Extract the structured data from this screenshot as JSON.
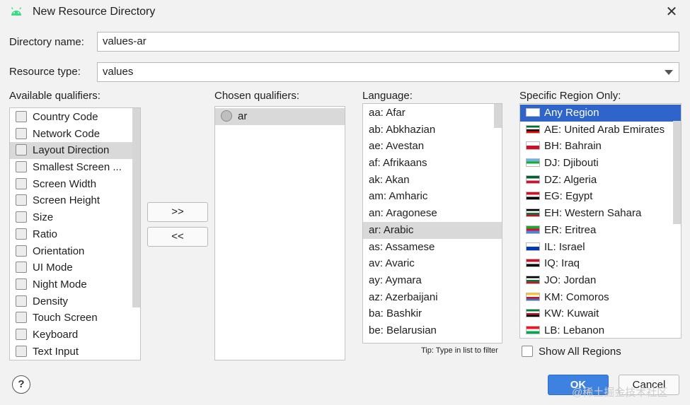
{
  "window": {
    "title": "New Resource Directory",
    "close_glyph": "✕",
    "app_icon": "android-icon"
  },
  "directory_name": {
    "label": "Directory name:",
    "value": "values-ar"
  },
  "resource_type": {
    "label": "Resource type:",
    "value": "values"
  },
  "available": {
    "label": "Available qualifiers:",
    "items": [
      {
        "label": "Country Code",
        "icon": "country-code-icon"
      },
      {
        "label": "Network Code",
        "icon": "network-code-icon"
      },
      {
        "label": "Layout Direction",
        "icon": "layout-direction-icon"
      },
      {
        "label": "Smallest Screen ...",
        "icon": "smallest-screen-icon"
      },
      {
        "label": "Screen Width",
        "icon": "screen-width-icon"
      },
      {
        "label": "Screen Height",
        "icon": "screen-height-icon"
      },
      {
        "label": "Size",
        "icon": "size-icon"
      },
      {
        "label": "Ratio",
        "icon": "ratio-icon"
      },
      {
        "label": "Orientation",
        "icon": "orientation-icon"
      },
      {
        "label": "UI Mode",
        "icon": "ui-mode-icon"
      },
      {
        "label": "Night Mode",
        "icon": "night-mode-icon"
      },
      {
        "label": "Density",
        "icon": "density-icon"
      },
      {
        "label": "Touch Screen",
        "icon": "touch-screen-icon"
      },
      {
        "label": "Keyboard",
        "icon": "keyboard-icon"
      },
      {
        "label": "Text Input",
        "icon": "text-input-icon"
      }
    ],
    "selected": "Layout Direction"
  },
  "move": {
    "add_label": ">>",
    "remove_label": "<<"
  },
  "chosen": {
    "label": "Chosen qualifiers:",
    "items": [
      {
        "label": "ar",
        "icon": "globe-icon"
      }
    ]
  },
  "language": {
    "label": "Language:",
    "items": [
      "aa: Afar",
      "ab: Abkhazian",
      "ae: Avestan",
      "af: Afrikaans",
      "ak: Akan",
      "am: Amharic",
      "an: Aragonese",
      "ar: Arabic",
      "as: Assamese",
      "av: Avaric",
      "ay: Aymara",
      "az: Azerbaijani",
      "ba: Bashkir",
      "be: Belarusian"
    ],
    "selected": "ar: Arabic",
    "tip": "Tip: Type in list to filter"
  },
  "region": {
    "label": "Specific Region Only:",
    "items": [
      {
        "label": "Any Region",
        "colors": [
          "#ffffff"
        ]
      },
      {
        "label": "AE: United Arab Emirates",
        "colors": [
          "#00732f",
          "#ffffff",
          "#000000",
          "#ff0000"
        ]
      },
      {
        "label": "BH: Bahrain",
        "colors": [
          "#ffffff",
          "#ce1126"
        ]
      },
      {
        "label": "DJ: Djibouti",
        "colors": [
          "#6ab2e7",
          "#12ad2b",
          "#ffffff"
        ]
      },
      {
        "label": "DZ: Algeria",
        "colors": [
          "#006233",
          "#ffffff",
          "#d21034"
        ]
      },
      {
        "label": "EG: Egypt",
        "colors": [
          "#ce1126",
          "#ffffff",
          "#000000"
        ]
      },
      {
        "label": "EH: Western Sahara",
        "colors": [
          "#000000",
          "#ffffff",
          "#007a3d",
          "#c4111b"
        ]
      },
      {
        "label": "ER: Eritrea",
        "colors": [
          "#12ad2b",
          "#ea0437",
          "#4189dd"
        ]
      },
      {
        "label": "IL: Israel",
        "colors": [
          "#ffffff",
          "#0038b8"
        ]
      },
      {
        "label": "IQ: Iraq",
        "colors": [
          "#ce1126",
          "#ffffff",
          "#000000"
        ]
      },
      {
        "label": "JO: Jordan",
        "colors": [
          "#000000",
          "#ffffff",
          "#007a3d",
          "#ce1126"
        ]
      },
      {
        "label": "KM: Comoros",
        "colors": [
          "#ffc61e",
          "#ffffff",
          "#ce1126",
          "#3a75c4"
        ]
      },
      {
        "label": "KW: Kuwait",
        "colors": [
          "#007a3d",
          "#ffffff",
          "#ce1126",
          "#000000"
        ]
      },
      {
        "label": "LB: Lebanon",
        "colors": [
          "#ee161f",
          "#ffffff",
          "#00a850"
        ]
      }
    ],
    "selected": "Any Region",
    "show_all_label": "Show All Regions",
    "show_all_checked": false
  },
  "footer": {
    "help_glyph": "?",
    "ok_label": "OK",
    "cancel_label": "Cancel",
    "watermark": "@稀土掘金技术社区"
  },
  "colors": {
    "selection_blue": "#2f65ca",
    "selection_gray": "#d9d9d9",
    "primary_button": "#3d82e0"
  }
}
